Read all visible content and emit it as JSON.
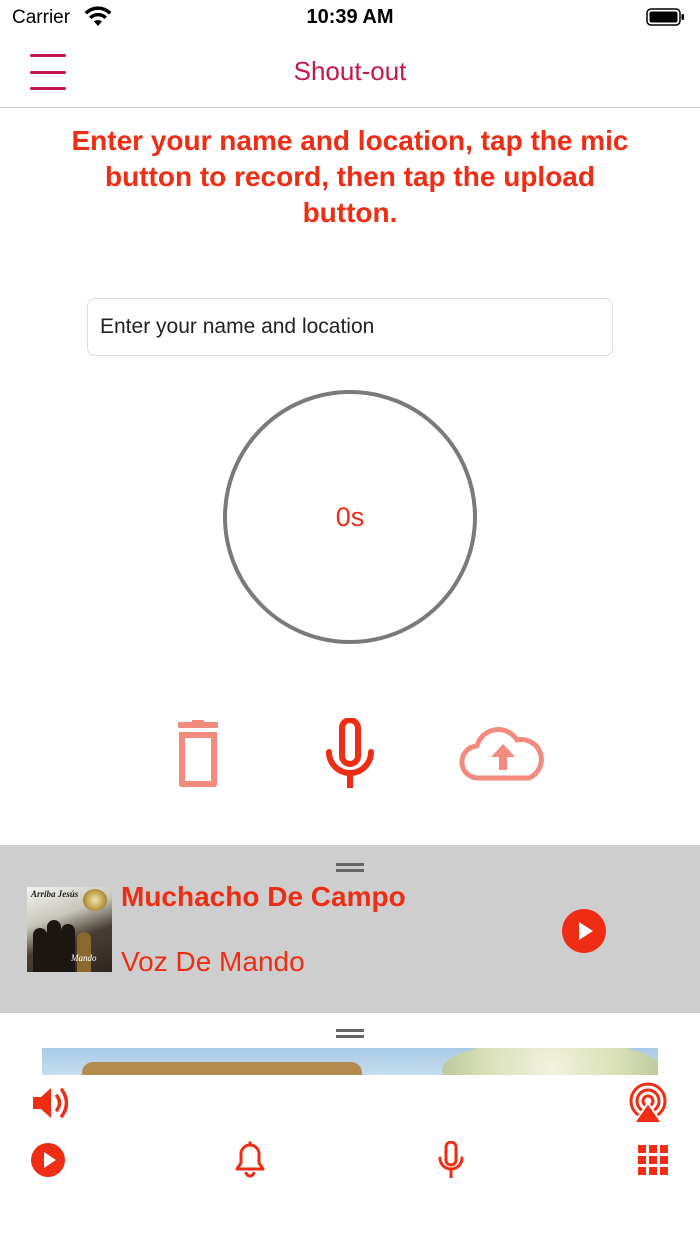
{
  "status_bar": {
    "carrier": "Carrier",
    "time": "10:39 AM"
  },
  "nav": {
    "title": "Shout-out"
  },
  "instructions": "Enter your name and location, tap the mic button to record, then tap the upload button.",
  "name_input": {
    "placeholder": "Enter your name and location",
    "value": ""
  },
  "timer": {
    "label": "0s"
  },
  "controls": [
    "trash-icon",
    "microphone-icon",
    "cloud-upload-icon"
  ],
  "now_playing": {
    "title": "Muchacho De Campo",
    "artist": "Voz De Mando",
    "album_art_text": [
      "Arriba Jesús",
      "Voz De Mando",
      "Mando"
    ]
  },
  "bottom_bar_icons": [
    "volume-icon",
    "airplay-icon",
    "play-icon",
    "bell-icon",
    "microphone-icon",
    "grid-icon"
  ],
  "colors": {
    "accent": "#ee2d14",
    "title": "#c4174b",
    "muted_icon": "#f28a7d",
    "player_bg": "#cecece"
  }
}
